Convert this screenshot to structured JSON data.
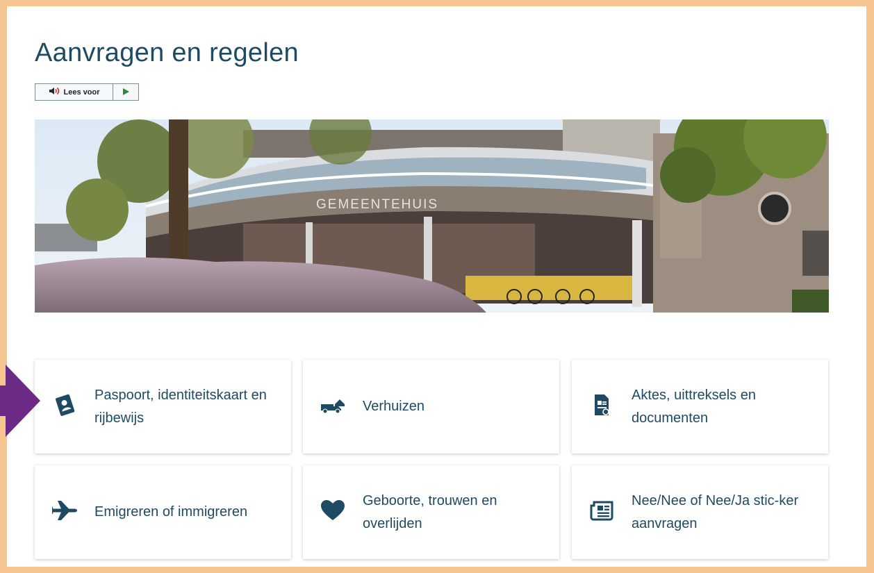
{
  "page": {
    "title": "Aanvragen en regelen",
    "readspeaker_label": "Lees voor"
  },
  "hero": {
    "building_sign": "GEMEENTEHUIS"
  },
  "cards": [
    {
      "label": "Paspoort, identiteitskaart en rijbewijs",
      "icon": "passport-icon"
    },
    {
      "label": "Verhuizen",
      "icon": "moving-truck-icon"
    },
    {
      "label": "Aktes, uittreksels en documenten",
      "icon": "certificate-icon"
    },
    {
      "label": "Emigreren of immigreren",
      "icon": "airplane-icon"
    },
    {
      "label": "Geboorte, trouwen en overlijden",
      "icon": "heart-icon"
    },
    {
      "label": "Nee/Nee of Nee/Ja stic-ker aanvragen",
      "icon": "newspaper-icon"
    }
  ],
  "colors": {
    "frame": "#f6c58f",
    "text_primary": "#1f4a63",
    "annotation_arrow": "#6a2a86"
  }
}
